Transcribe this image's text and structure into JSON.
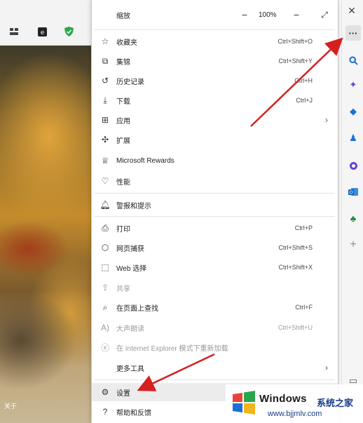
{
  "browser": {
    "toolbar_icons": [
      "collections-icon",
      "extension-e-icon",
      "shield-icon"
    ],
    "painting_caption": "关于"
  },
  "menu": {
    "zoom": {
      "label": "缩放",
      "value": "100%"
    },
    "items": [
      {
        "name": "favorites",
        "label": "收藏夹",
        "shortcut": "Ctrl+Shift+O",
        "icon": "star-list-icon"
      },
      {
        "name": "collections",
        "label": "集锦",
        "shortcut": "Ctrl+Shift+Y",
        "icon": "collections-icon"
      },
      {
        "name": "history",
        "label": "历史记录",
        "shortcut": "Ctrl+H",
        "icon": "history-icon"
      },
      {
        "name": "downloads",
        "label": "下载",
        "shortcut": "Ctrl+J",
        "icon": "download-icon"
      },
      {
        "name": "apps",
        "label": "应用",
        "shortcut": "",
        "icon": "apps-icon"
      },
      {
        "name": "extensions",
        "label": "扩展",
        "shortcut": "",
        "icon": "puzzle-icon"
      },
      {
        "name": "rewards",
        "label": "Microsoft Rewards",
        "shortcut": "",
        "icon": "trophy-icon"
      },
      {
        "name": "performance",
        "label": "性能",
        "shortcut": "",
        "icon": "heart-pulse-icon"
      },
      {
        "name": "alerts",
        "label": "警报和提示",
        "shortcut": "",
        "icon": "bell-icon"
      },
      {
        "name": "print",
        "label": "打印",
        "shortcut": "Ctrl+P",
        "icon": "printer-icon"
      },
      {
        "name": "web-capture",
        "label": "网页捕获",
        "shortcut": "Ctrl+Shift+S",
        "icon": "capture-icon"
      },
      {
        "name": "web-select",
        "label": "Web 选择",
        "shortcut": "Ctrl+Shift+X",
        "icon": "select-icon"
      },
      {
        "name": "share",
        "label": "共享",
        "shortcut": "",
        "icon": "share-icon"
      },
      {
        "name": "find",
        "label": "在页面上查找",
        "shortcut": "Ctrl+F",
        "icon": "find-icon"
      },
      {
        "name": "read-aloud",
        "label": "大声朗读",
        "shortcut": "Ctrl+Shift+U",
        "icon": "read-aloud-icon"
      },
      {
        "name": "ie-mode",
        "label": "在 Internet Explorer 模式下重新加载",
        "shortcut": "",
        "icon": "ie-icon"
      },
      {
        "name": "more-tools",
        "label": "更多工具",
        "shortcut": "",
        "icon": ""
      },
      {
        "name": "settings",
        "label": "设置",
        "shortcut": "",
        "icon": "gear-icon"
      },
      {
        "name": "help",
        "label": "帮助和反馈",
        "shortcut": "",
        "icon": "help-icon"
      }
    ]
  },
  "sidebar": {
    "more_label": "···",
    "close_label": "✕",
    "add_label": "+"
  },
  "watermark": {
    "title": "Windows",
    "site": "系统之家",
    "url": "www.bjjmlv.com"
  },
  "colors": {
    "arrow": "#d42020",
    "sidebar_blue": "#1a6fd8",
    "sidebar_purple": "#6a3fd8",
    "sidebar_green": "#188a3c"
  }
}
